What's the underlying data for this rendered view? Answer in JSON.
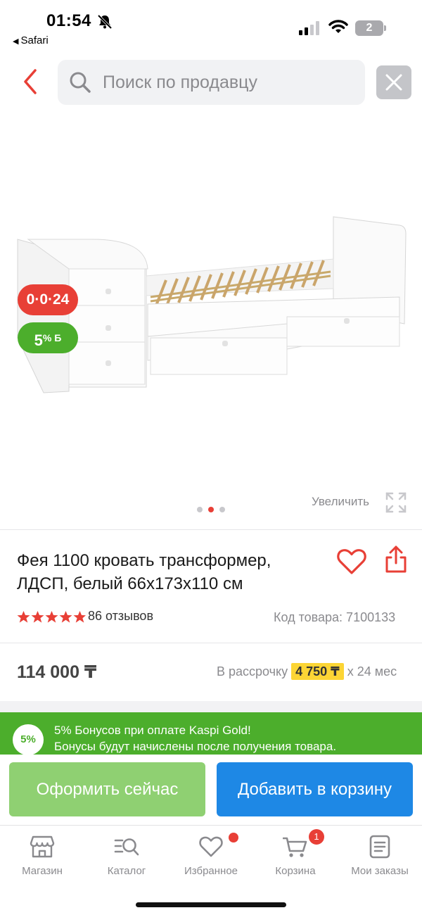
{
  "status_bar": {
    "time": "01:54",
    "back_app": "Safari",
    "battery": "2"
  },
  "search": {
    "placeholder": "Поиск по продавцу"
  },
  "product": {
    "installment_badge": "0·0·24",
    "bonus_badge_value": "5",
    "bonus_badge_suffix": "% Б",
    "zoom_label": "Увеличить",
    "title": "Фея 1100 кровать трансформер, ЛДСП, белый 66x173x110 см",
    "rating": 5,
    "reviews": "86 отзывов",
    "sku": "Код товара: 7100133",
    "gallery": {
      "count": 3,
      "active": 2
    }
  },
  "price": {
    "value": "114 000 ₸",
    "installment_prefix": "В рассрочку",
    "installment_amount": "4 750 ₸",
    "installment_suffix": "x 24 мес"
  },
  "bonus_banner": {
    "badge": "5%",
    "line1": "5% Бонусов при оплате Kaspi Gold!",
    "line2": "Бонусы будут начислены после получения товара."
  },
  "actions": {
    "checkout": "Оформить сейчас",
    "add_to_cart": "Добавить в корзину"
  },
  "tabs": [
    {
      "label": "Магазин",
      "icon": "store-icon"
    },
    {
      "label": "Каталог",
      "icon": "catalog-search-icon"
    },
    {
      "label": "Избранное",
      "icon": "heart-icon"
    },
    {
      "label": "Корзина",
      "icon": "cart-icon",
      "badge": "1"
    },
    {
      "label": "Мои заказы",
      "icon": "orders-icon"
    }
  ],
  "colors": {
    "accent_red": "#e83f36",
    "bonus_green": "#4cae2c",
    "checkout_green": "#8fd072",
    "cart_blue": "#1e88e5",
    "installment_yellow": "#fcd535"
  }
}
